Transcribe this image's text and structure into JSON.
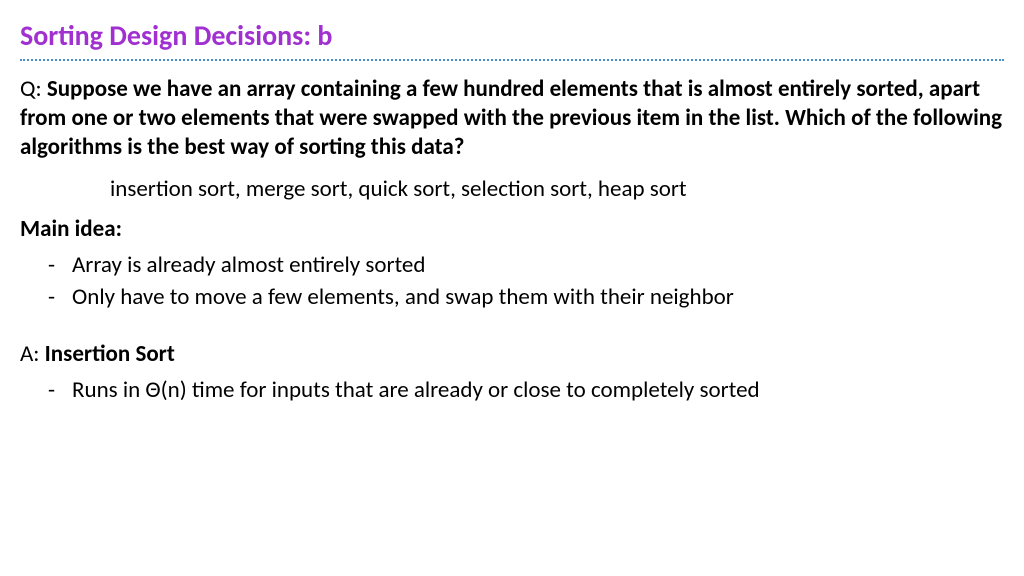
{
  "title": "Sorting Design Decisions: b",
  "question": {
    "label": "Q: ",
    "body": "Suppose we have an array containing a few hundred elements that is almost entirely sorted, apart from one or two elements that were swapped with the previous item in the list. Which of the following algorithms is the best way of sorting this data?"
  },
  "options": "insertion sort, merge sort, quick sort, selection sort, heap sort",
  "main_idea_label": "Main idea:",
  "main_idea": [
    "Array is already almost entirely sorted",
    "Only have to move a few elements, and swap them with their neighbor"
  ],
  "answer": {
    "label": "A: ",
    "body": "Insertion Sort"
  },
  "answer_points": [
    "Runs in Θ(n) time for inputs that are already or close to completely sorted"
  ]
}
